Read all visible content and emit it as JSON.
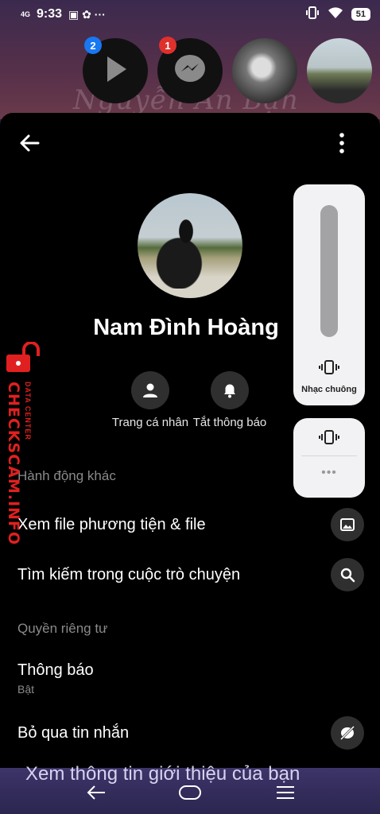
{
  "status_bar": {
    "time": "9:33",
    "network": "4G",
    "battery": "51"
  },
  "bubbles": [
    {
      "name": "play-bubble",
      "badge": "2",
      "badge_color": "#1877f2"
    },
    {
      "name": "messenger-bubble",
      "badge": "1",
      "badge_color": "#e0302c"
    }
  ],
  "wallpaper_text": "Nguyễn An Bạn",
  "profile": {
    "name": "Nam Đình Hoàng"
  },
  "actions": [
    {
      "label": "Trang cá nhân",
      "icon": "person-icon"
    },
    {
      "label": "Tắt thông báo",
      "icon": "bell-icon"
    }
  ],
  "sections": {
    "other_actions": "Hành động khác",
    "privacy": "Quyền riêng tư"
  },
  "rows": {
    "media": "Xem file phương tiện & file",
    "search": "Tìm kiếm trong cuộc trò chuyện",
    "notifications": "Thông báo",
    "notifications_value": "Bật",
    "ignore": "Bỏ qua tin nhắn"
  },
  "volume": {
    "label": "Nhạc chuông",
    "dots": "•••"
  },
  "watermark": {
    "main": "CHECKSCAM.INFO",
    "sub": "DATA CENTER"
  },
  "bottom_peek": "Xem thông tin giới thiệu của bạn"
}
